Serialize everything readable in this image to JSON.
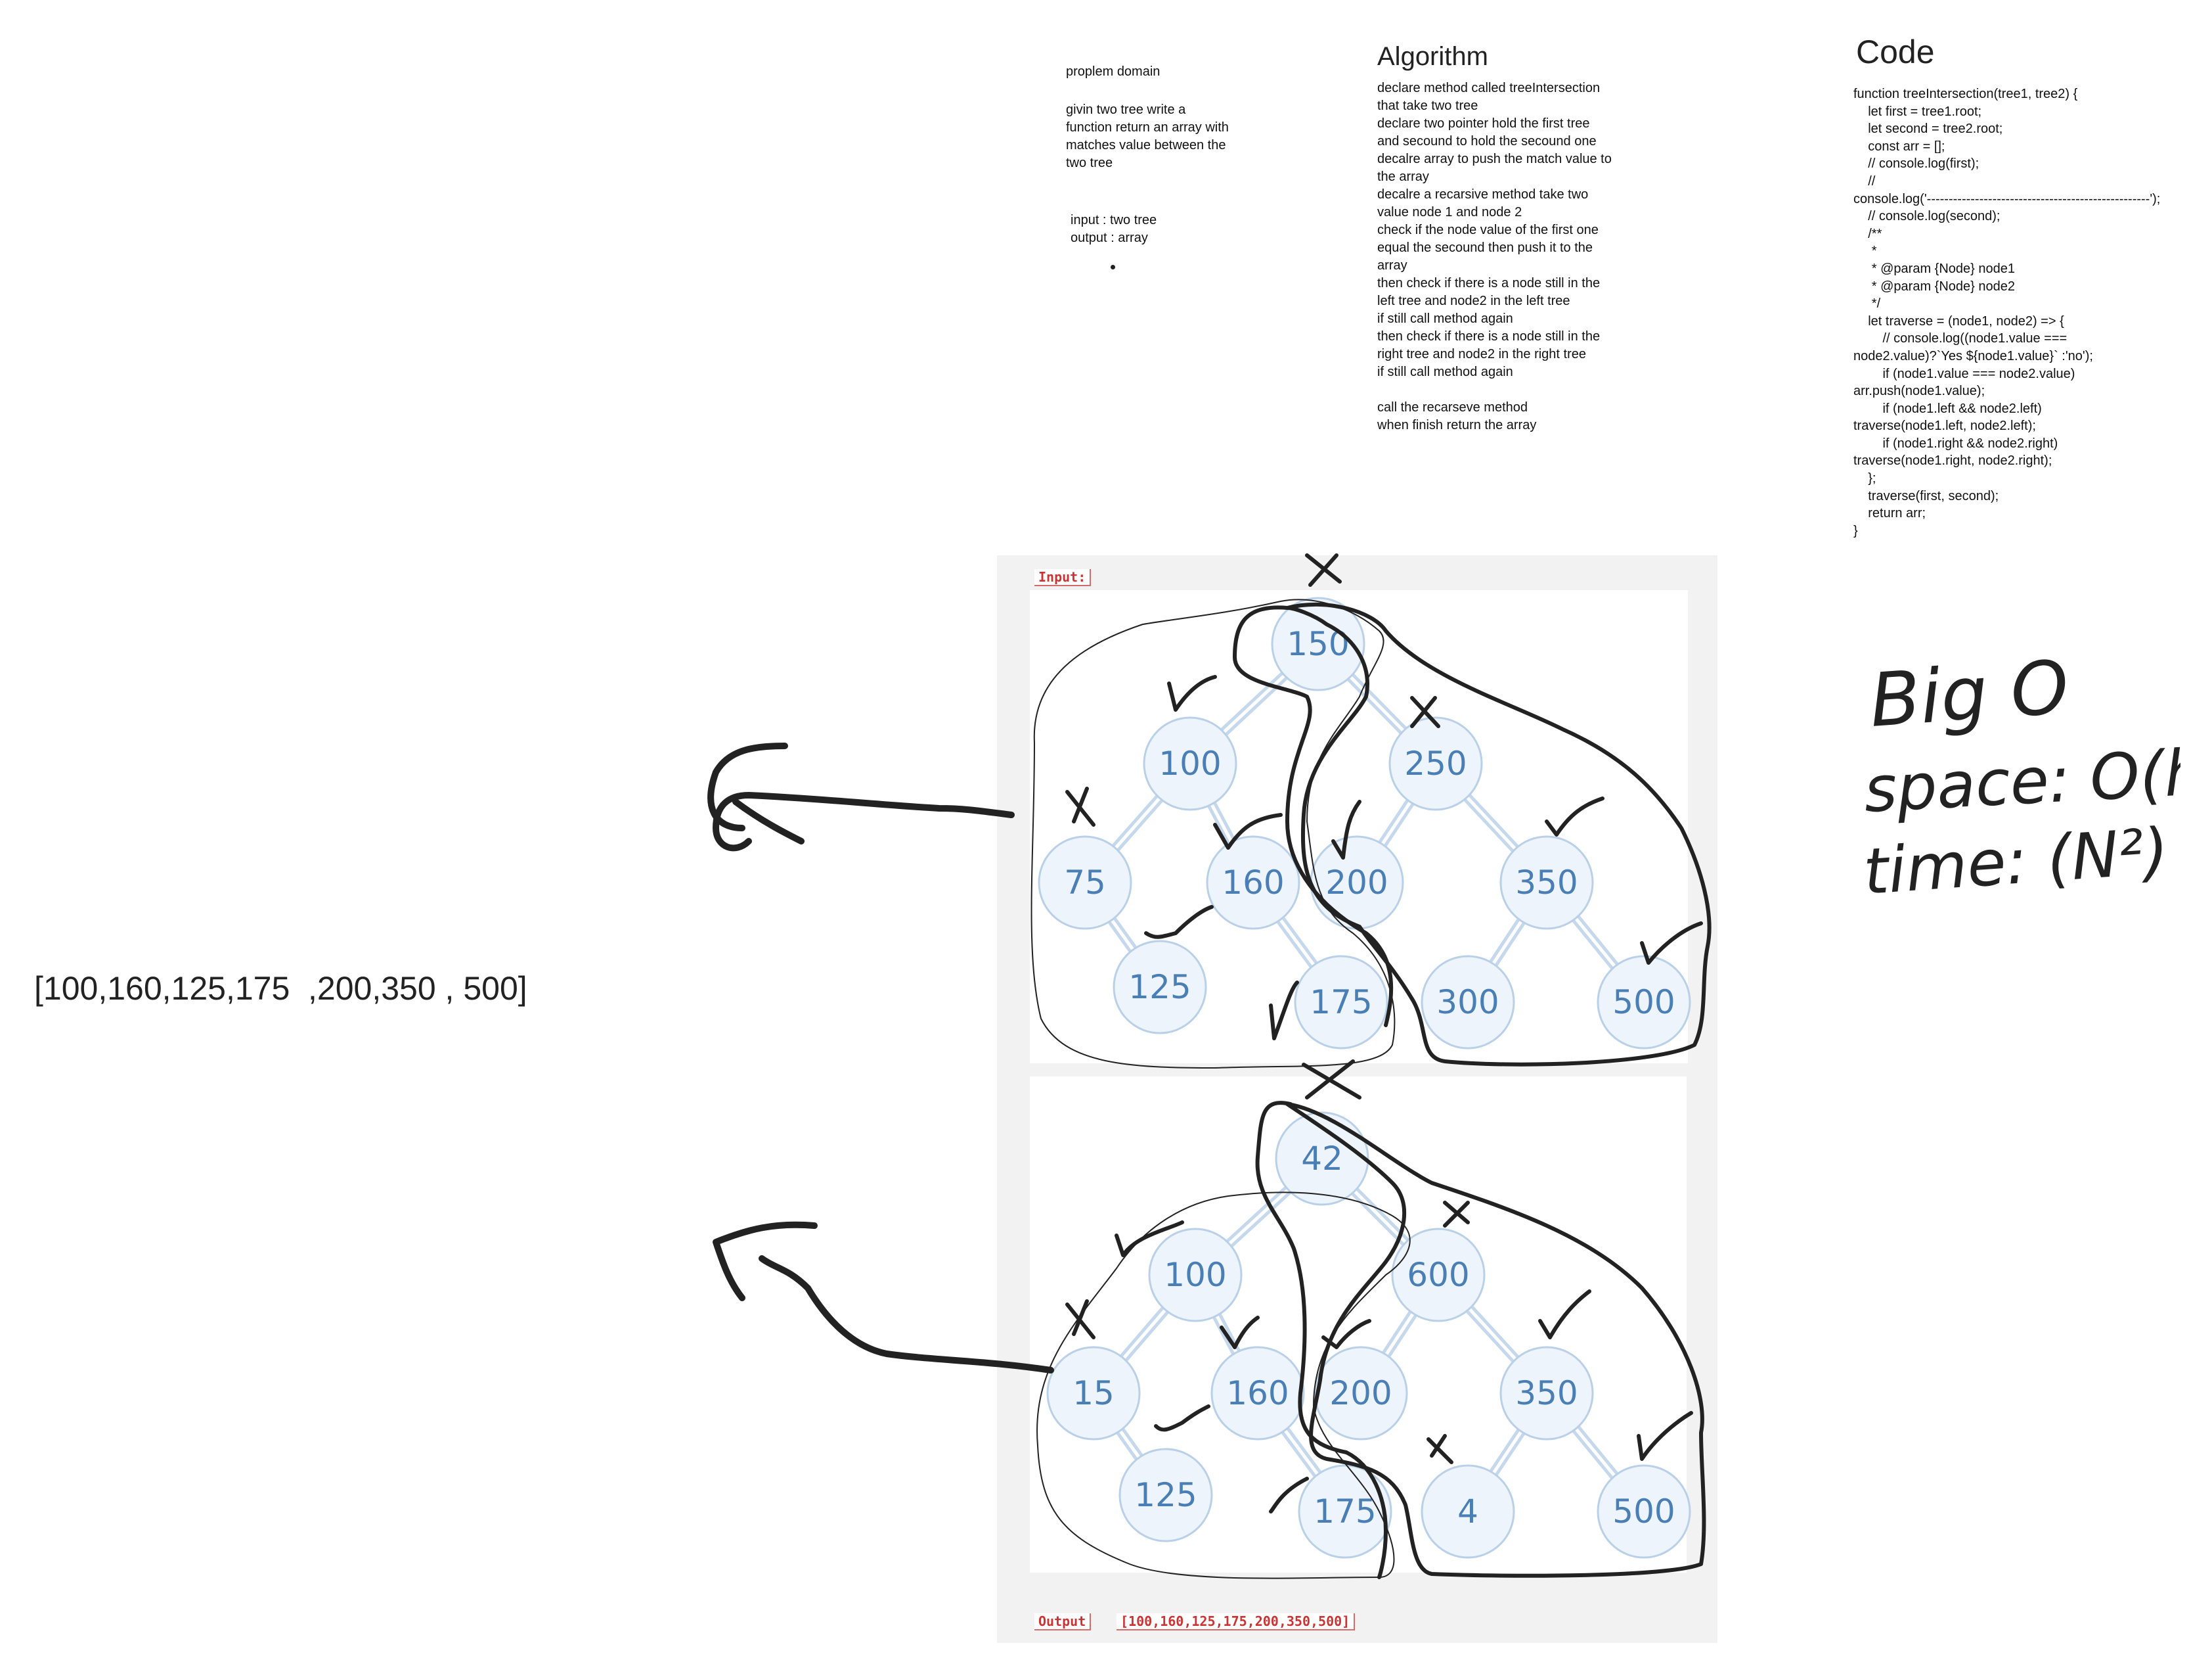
{
  "problem": {
    "title": "proplem domain",
    "lines": [
      "givin two tree write a",
      "function return an array with",
      "matches value between the",
      "two tree"
    ],
    "input": "input : two tree",
    "output": "output : array"
  },
  "algorithm": {
    "heading": "Algorithm",
    "lines": [
      "declare method called treeIntersection",
      "that take two tree",
      "declare two pointer hold the first tree",
      "and secound to hold the secound one",
      "decalre array to push the match value to",
      "the array",
      "decalre a recarsive method take two",
      "value node 1 and node 2",
      "check if the node value of the first one",
      "equal the secound  then push it to the",
      "array",
      "then check if there is a node still in the",
      "left tree and node2 in the left tree",
      "if still call method again",
      "then check if there is a node still in the",
      "right tree and node2 in the right tree",
      "if still call method again",
      "",
      "call the recarseve method",
      "when finish return the array"
    ]
  },
  "code": {
    "heading": "Code",
    "lines": [
      "function treeIntersection(tree1, tree2) {",
      "    let first = tree1.root;",
      "    let second = tree2.root;",
      "    const arr = [];",
      "    // console.log(first);",
      "    //",
      "console.log('---------------------------------------------------');",
      "    // console.log(second);",
      "    /**",
      "     *",
      "     * @param {Node} node1",
      "     * @param {Node} node2",
      "     */",
      "    let traverse = (node1, node2) => {",
      "        // console.log((node1.value ===",
      "node2.value)?`Yes ${node1.value}` :'no');",
      "        if (node1.value === node2.value)",
      "arr.push(node1.value);",
      "        if (node1.left && node2.left)",
      "traverse(node1.left, node2.left);",
      "        if (node1.right && node2.right)",
      "traverse(node1.right, node2.right);",
      "    };",
      "    traverse(first, second);",
      "    return arr;",
      "}"
    ]
  },
  "bigo": {
    "title": "Big O",
    "space": "space: O(h)",
    "time": "time: (N²)"
  },
  "result": "[100,160,125,175  ,200,350 , 500]",
  "labels": {
    "input": "Input:",
    "output": "Output",
    "output_value": "[100,160,125,175,200,350,500]"
  },
  "tree1": {
    "nodes": [
      "150",
      "100",
      "250",
      "75",
      "160",
      "200",
      "350",
      "125",
      "175",
      "300",
      "500"
    ]
  },
  "tree2": {
    "nodes": [
      "42",
      "100",
      "600",
      "15",
      "160",
      "200",
      "350",
      "125",
      "175",
      "4",
      "500"
    ]
  },
  "colors": {
    "node_fill": "#eef4fb",
    "node_stroke": "#b9d0e8",
    "node_text": "#4a7fb5",
    "edge": "#c5d8ec",
    "label_red": "#cc3333",
    "ink": "#222222"
  }
}
